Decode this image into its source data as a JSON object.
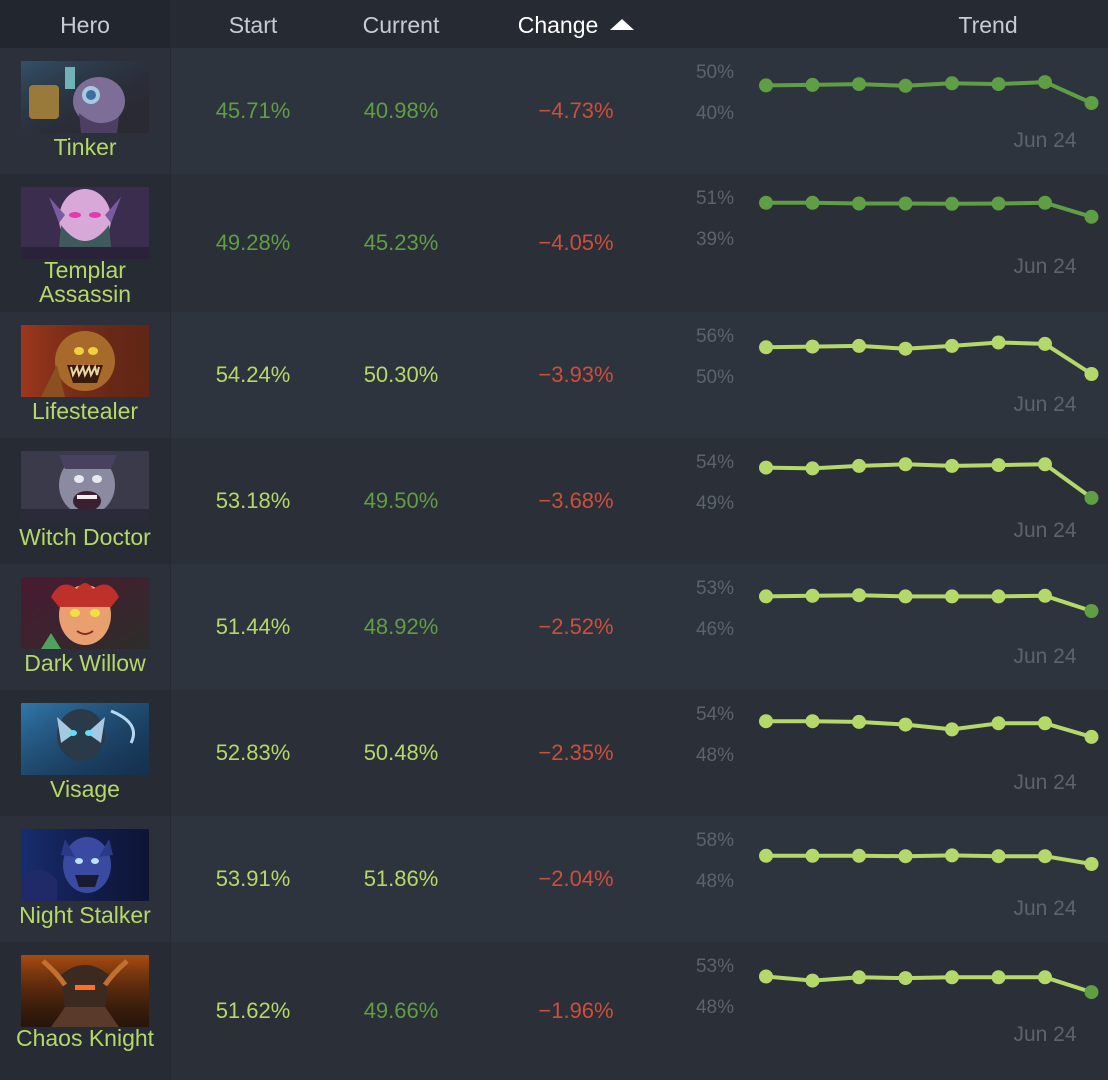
{
  "header": {
    "hero": "Hero",
    "start": "Start",
    "current": "Current",
    "change": "Change",
    "trend": "Trend"
  },
  "colors": {
    "positive_dark": "#5f9e45",
    "positive_light": "#b5d86a",
    "negative": "#cc4e3c"
  },
  "rows": [
    {
      "hero": "Tinker",
      "portrait_icon": "tinker-portrait",
      "start": "45.71%",
      "current": "40.98%",
      "change": "-4.73%",
      "start_tone": "dark",
      "current_tone": "dark",
      "trend": {
        "ymax_label": "50%",
        "ymin_label": "40%",
        "date_label": "Jun 24",
        "values": [
          46.5,
          46.6,
          46.8,
          46.4,
          47.0,
          46.8,
          47.3,
          42.2
        ],
        "color": "#5f9e45"
      }
    },
    {
      "hero": "Templar Assassin",
      "portrait_icon": "templar-assassin-portrait",
      "start": "49.28%",
      "current": "45.23%",
      "change": "-4.05%",
      "start_tone": "dark",
      "current_tone": "dark",
      "trend": {
        "ymax_label": "51%",
        "ymin_label": "39%",
        "date_label": "Jun 24",
        "values": [
          49.3,
          49.3,
          49.1,
          49.1,
          49.0,
          49.1,
          49.3,
          45.2
        ],
        "color": "#5f9e45"
      }
    },
    {
      "hero": "Lifestealer",
      "portrait_icon": "lifestealer-portrait",
      "start": "54.24%",
      "current": "50.30%",
      "change": "-3.93%",
      "start_tone": "light",
      "current_tone": "light",
      "trend": {
        "ymax_label": "56%",
        "ymin_label": "50%",
        "date_label": "Jun 24",
        "values": [
          54.2,
          54.3,
          54.4,
          54.0,
          54.4,
          54.9,
          54.7,
          50.3
        ],
        "color": "#b5d86a"
      }
    },
    {
      "hero": "Witch Doctor",
      "portrait_icon": "witch-doctor-portrait",
      "start": "53.18%",
      "current": "49.50%",
      "change": "-3.68%",
      "start_tone": "light",
      "current_tone": "dark",
      "trend": {
        "ymax_label": "54%",
        "ymin_label": "49%",
        "date_label": "Jun 24",
        "values": [
          53.2,
          53.1,
          53.4,
          53.6,
          53.4,
          53.5,
          53.6,
          49.5
        ],
        "color": "#b5d86a",
        "last_color": "#5f9e45"
      }
    },
    {
      "hero": "Dark Willow",
      "portrait_icon": "dark-willow-portrait",
      "start": "51.44%",
      "current": "48.92%",
      "change": "-2.52%",
      "start_tone": "light",
      "current_tone": "dark",
      "trend": {
        "ymax_label": "53%",
        "ymin_label": "46%",
        "date_label": "Jun 24",
        "values": [
          51.4,
          51.5,
          51.6,
          51.4,
          51.4,
          51.4,
          51.5,
          48.9
        ],
        "color": "#b5d86a",
        "last_color": "#5f9e45"
      }
    },
    {
      "hero": "Visage",
      "portrait_icon": "visage-portrait",
      "start": "52.83%",
      "current": "50.48%",
      "change": "-2.35%",
      "start_tone": "light",
      "current_tone": "light",
      "trend": {
        "ymax_label": "54%",
        "ymin_label": "48%",
        "date_label": "Jun 24",
        "values": [
          52.8,
          52.8,
          52.7,
          52.3,
          51.6,
          52.5,
          52.5,
          50.5
        ],
        "color": "#b5d86a"
      }
    },
    {
      "hero": "Night Stalker",
      "portrait_icon": "night-stalker-portrait",
      "start": "53.91%",
      "current": "51.86%",
      "change": "-2.04%",
      "start_tone": "light",
      "current_tone": "light",
      "trend": {
        "ymax_label": "58%",
        "ymin_label": "48%",
        "date_label": "Jun 24",
        "values": [
          53.9,
          53.9,
          53.9,
          53.8,
          54.0,
          53.8,
          53.8,
          51.9
        ],
        "color": "#b5d86a"
      }
    },
    {
      "hero": "Chaos Knight",
      "portrait_icon": "chaos-knight-portrait",
      "start": "51.62%",
      "current": "49.66%",
      "change": "-1.96%",
      "start_tone": "light",
      "current_tone": "dark",
      "trend": {
        "ymax_label": "53%",
        "ymin_label": "48%",
        "date_label": "Jun 24",
        "values": [
          51.6,
          51.1,
          51.5,
          51.4,
          51.5,
          51.5,
          51.5,
          49.7
        ],
        "color": "#b5d86a",
        "last_color": "#5f9e45"
      }
    }
  ]
}
